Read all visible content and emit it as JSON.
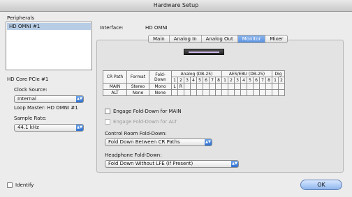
{
  "window": {
    "title": "Hardware Setup"
  },
  "sidebar": {
    "peripherals_label": "Peripherals",
    "peripherals": [
      "HD OMNI #1"
    ],
    "core_label": "HD Core PCIe #1",
    "clock_source_label": "Clock Source:",
    "clock_source_value": "Internal",
    "loop_master": "Loop Master: HD OMNI #1",
    "sample_rate_label": "Sample Rate:",
    "sample_rate_value": "44.1 kHz",
    "identify_label": "Identify"
  },
  "main": {
    "interface_label": "Interface:",
    "interface_value": "HD OMNI",
    "tabs": [
      "Main",
      "Analog In",
      "Analog Out",
      "Monitor",
      "Mixer"
    ],
    "active_tab": "Monitor",
    "table": {
      "headers": {
        "cr_path": "CR Path",
        "format": "Format",
        "fold_down": "Fold-Down",
        "analog": "Analog (DB-25)",
        "aes": "AES/EBU (DB-25)",
        "dig": "Dig"
      },
      "analog_numbers": [
        "1",
        "2",
        "3",
        "4",
        "5",
        "6",
        "7",
        "8"
      ],
      "aes_numbers": [
        "1",
        "2",
        "3",
        "4",
        "5",
        "6",
        "7",
        "8"
      ],
      "dig_numbers": [
        "1",
        "2"
      ],
      "rows": [
        {
          "path": "MAIN",
          "format": "Stereo",
          "fold": "Mono",
          "analog": [
            "L",
            "R",
            "",
            "",
            "",
            "",
            "",
            ""
          ]
        },
        {
          "path": "ALT",
          "format": "None",
          "fold": "None",
          "analog": [
            "",
            "",
            "",
            "",
            "",
            "",
            "",
            ""
          ]
        }
      ]
    },
    "engage_main": "Engage Fold-Down for MAIN",
    "engage_alt": "Engage Fold-Down for ALT",
    "cr_fold_label": "Control Room Fold-Down:",
    "cr_fold_value": "Fold Down Between CR Paths",
    "hp_fold_label": "Headphone Fold-Down:",
    "hp_fold_value": "Fold Down Without LFE (if Present)"
  },
  "footer": {
    "ok_label": "OK"
  }
}
